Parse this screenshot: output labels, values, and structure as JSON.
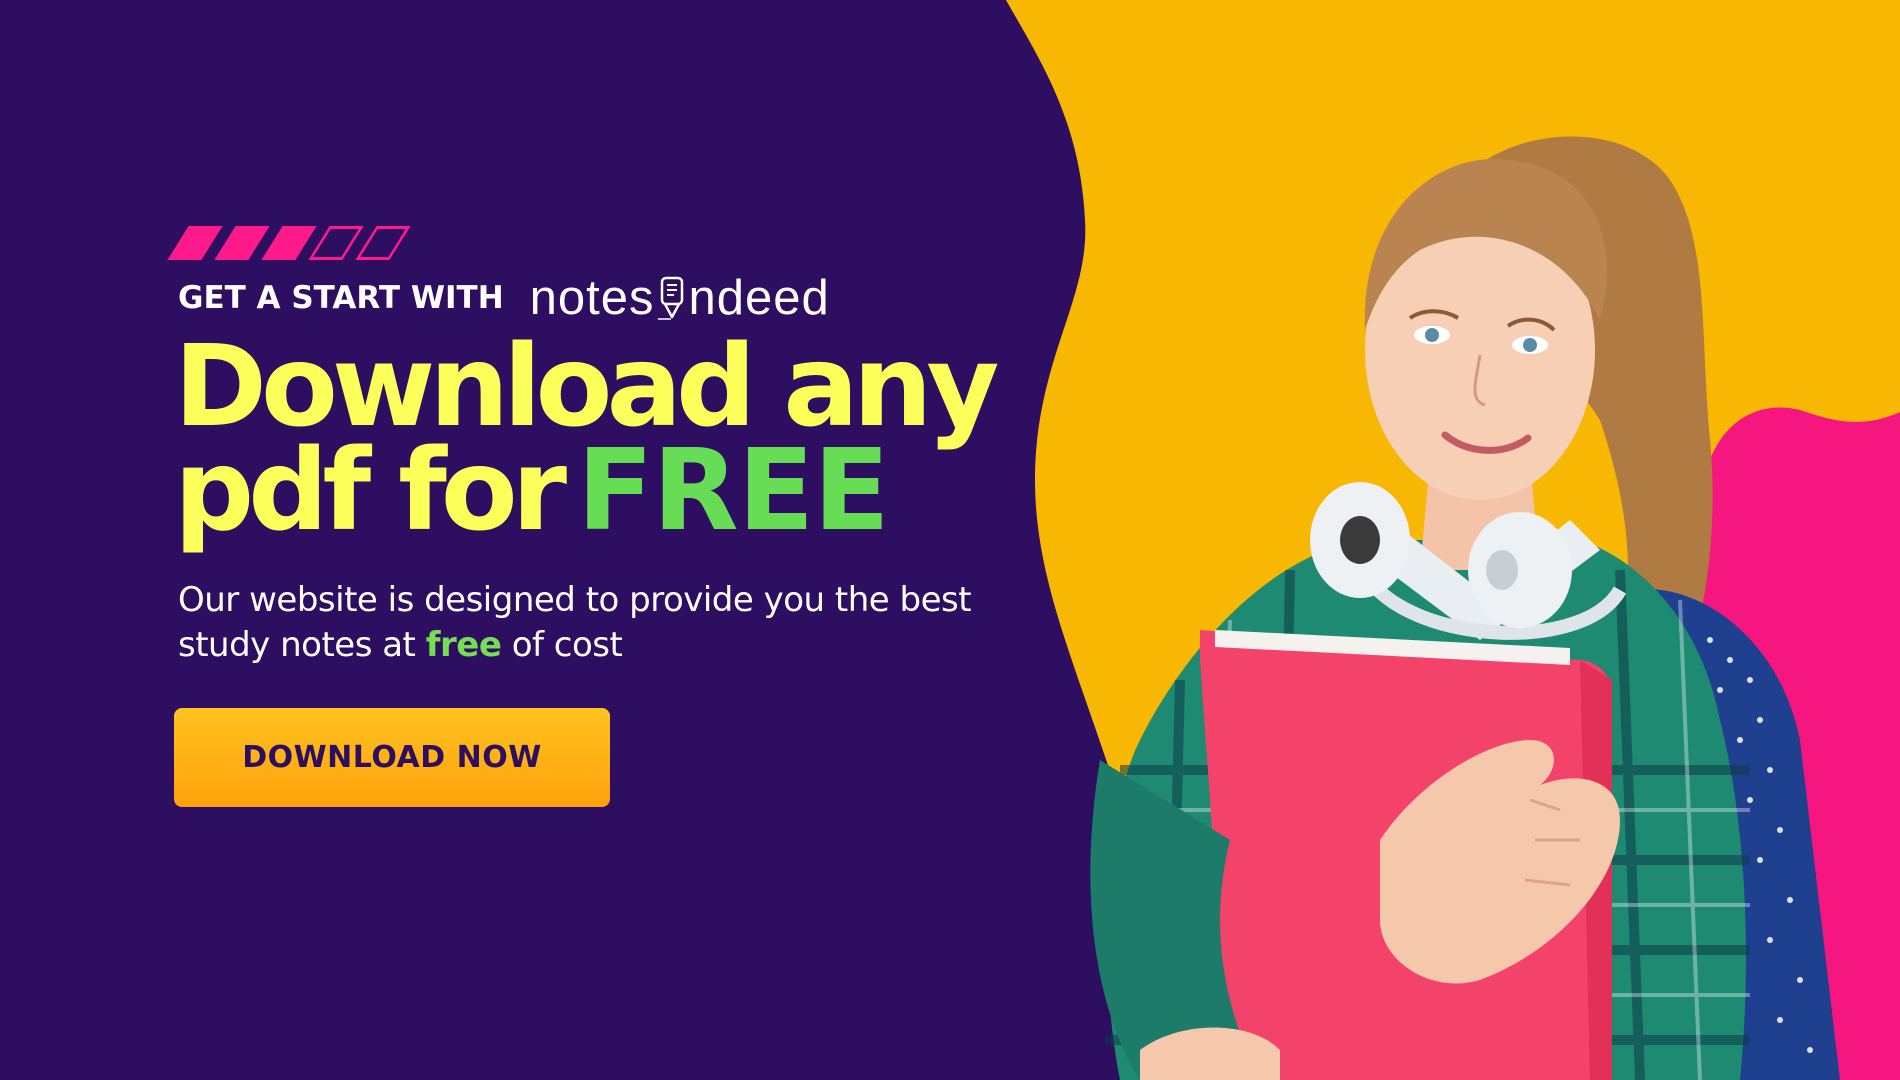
{
  "colors": {
    "background": "#2d0e61",
    "yellow_blob": "#f7b702",
    "pink_blob": "#f5167f",
    "headline": "#faff5a",
    "accent_green": "#66dd55",
    "stripes": "#ff1a8c",
    "button": "#ffb012",
    "button_text": "#2d0e61"
  },
  "header": {
    "kicker": "GET A START WITH",
    "brand_prefix": "notes",
    "brand_suffix": "ndeed",
    "brand_icon": "pen-notepad-icon"
  },
  "hero": {
    "headline_line1": "Download any",
    "headline_line2": "pdf for",
    "headline_accent": "FREE",
    "subtext_part1": "Our website is designed to provide you the best study notes at ",
    "subtext_highlight": "free",
    "subtext_part2": " of cost"
  },
  "cta": {
    "label": "DOWNLOAD NOW"
  },
  "image": {
    "subject": "student-photo"
  }
}
